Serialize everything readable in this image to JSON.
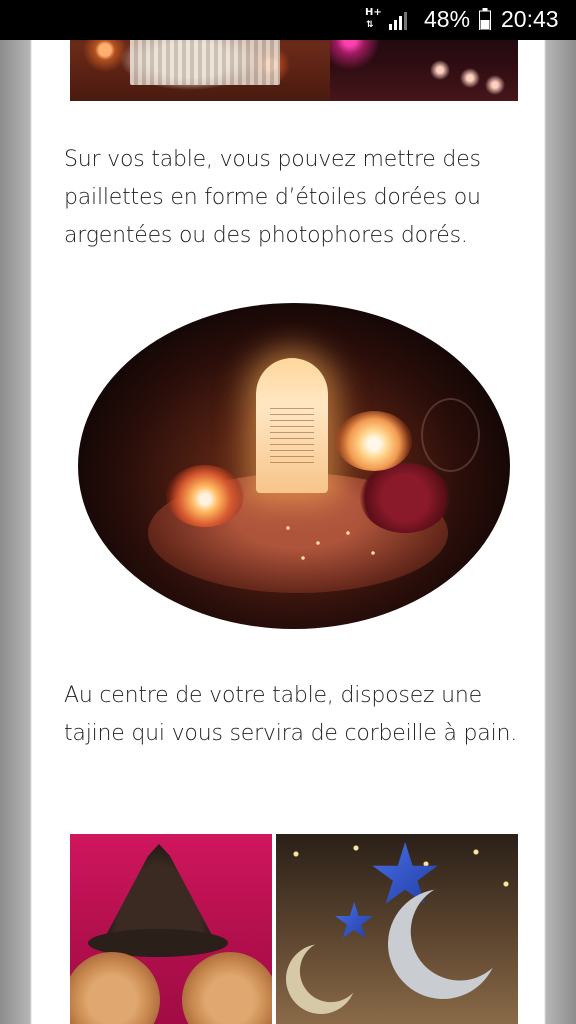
{
  "status_bar": {
    "network_type": "H+",
    "network_icon": "data-activity-arrows-icon",
    "signal_icon": "cell-signal-icon",
    "battery_percent": "48%",
    "battery_icon": "battery-icon",
    "time": "20:43"
  },
  "article": {
    "top_photo_pair": {
      "left_image": "candlelit-lounge-with-white-chairs-image",
      "right_image": "pink-lit-candle-room-image"
    },
    "paragraph_1": "Sur vos table, vous pouvez mettre des paillettes en forme d’étoiles dorées ou argentées ou des photophores dorés.",
    "oval_image": "candle-lantern-table-setting-image",
    "paragraph_2": "Au centre de votre table, disposez une tajine qui vous servira de corbeille à pain.",
    "bottom_photo_pair": {
      "left_image": "tajine-and-copper-plates-image",
      "right_image": "star-and-crescent-balloons-image"
    }
  },
  "colors": {
    "background_gutter": "#9a9a9a",
    "article_background": "#ffffff",
    "text": "#222222",
    "status_bar": "#000000"
  }
}
